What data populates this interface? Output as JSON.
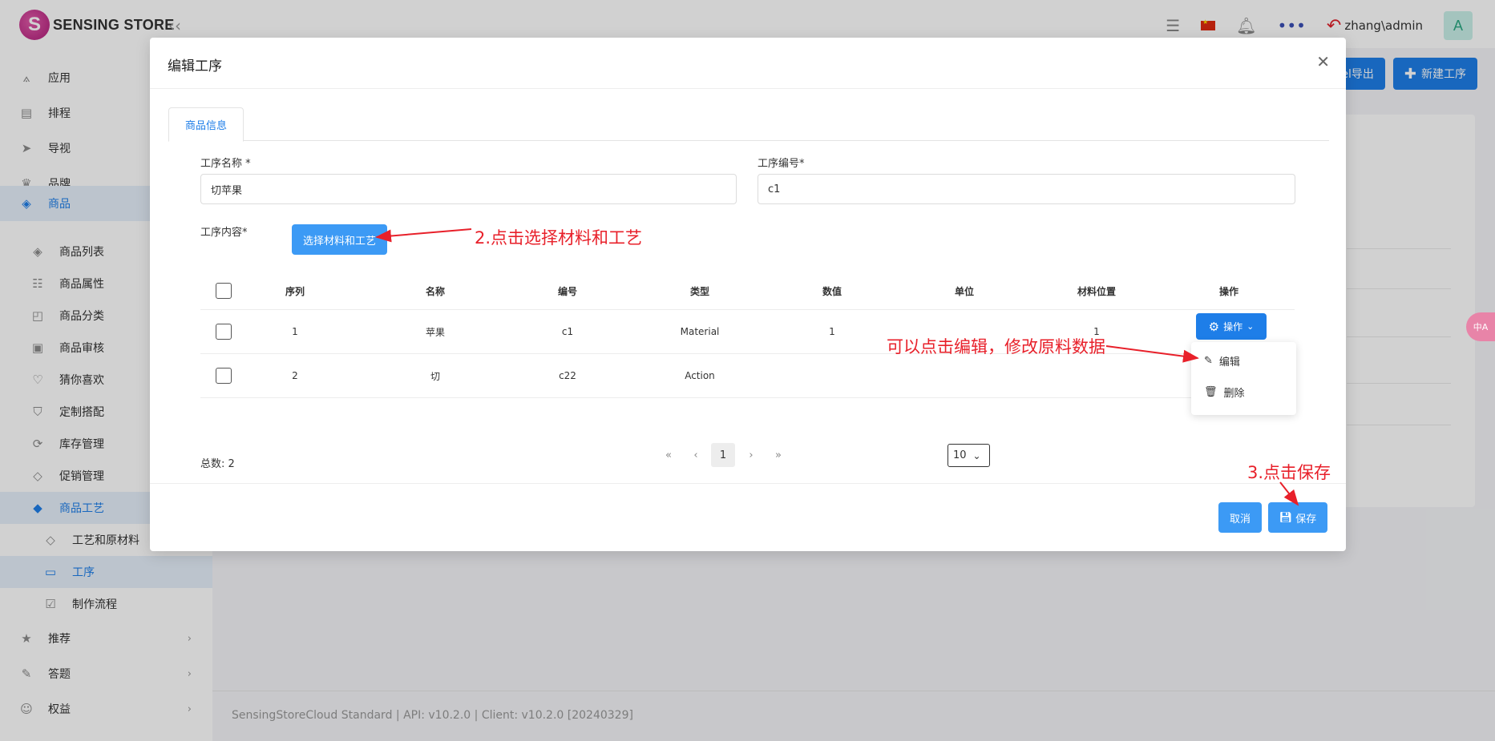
{
  "app": {
    "logo_text": "SENSING STORE",
    "logo_mark": "S",
    "user": "zhang\\admin",
    "avatar": "A",
    "top_buttons": {
      "export": "cel导出",
      "new": "新建工序"
    },
    "footer": "SensingStoreCloud Standard | API: v10.2.0 | Client: v10.2.0 [20240329]",
    "side_badge": "中A"
  },
  "sidebar": {
    "items": [
      {
        "label": "应用",
        "icon": "apps-icon"
      },
      {
        "label": "排程",
        "icon": "calendar-icon"
      },
      {
        "label": "导视",
        "icon": "navigation-icon"
      },
      {
        "label": "品牌",
        "icon": "crown-icon"
      },
      {
        "label": "商品",
        "icon": "cube-icon"
      },
      {
        "label": "商品列表",
        "icon": "cube-icon"
      },
      {
        "label": "商品属性",
        "icon": "list-icon"
      },
      {
        "label": "商品分类",
        "icon": "bag-icon"
      },
      {
        "label": "商品审核",
        "icon": "audit-icon"
      },
      {
        "label": "猜你喜欢",
        "icon": "heart-icon"
      },
      {
        "label": "定制搭配",
        "icon": "shirt-icon"
      },
      {
        "label": "库存管理",
        "icon": "sync-icon"
      },
      {
        "label": "促销管理",
        "icon": "tag-icon"
      },
      {
        "label": "商品工艺",
        "icon": "diamond-icon"
      },
      {
        "label": "工艺和原材料",
        "icon": "diamond-icon"
      },
      {
        "label": "工序",
        "icon": "chat-icon"
      },
      {
        "label": "制作流程",
        "icon": "checklist-icon"
      },
      {
        "label": "推荐",
        "icon": "star-icon"
      },
      {
        "label": "答题",
        "icon": "edit-icon"
      },
      {
        "label": "权益",
        "icon": "user-icon"
      }
    ]
  },
  "modal": {
    "title": "编辑工序",
    "tab": "商品信息",
    "name_label": "工序名称 *",
    "name_value": "切苹果",
    "code_label": "工序编号*",
    "code_value": "c1",
    "content_label": "工序内容*",
    "select_button": "选择材料和工艺",
    "table": {
      "headers": [
        "序列",
        "名称",
        "编号",
        "类型",
        "数值",
        "单位",
        "材料位置",
        "操作"
      ],
      "rows": [
        [
          "1",
          "苹果",
          "c1",
          "Material",
          "1",
          "",
          "1"
        ],
        [
          "2",
          "切",
          "c22",
          "Action",
          "",
          "",
          ""
        ]
      ]
    },
    "op_button": "操作",
    "dropdown": {
      "edit": "编辑",
      "delete": "删除"
    },
    "total": "总数: 2",
    "pager": {
      "first": "«",
      "prev": "‹",
      "current": "1",
      "next": "›",
      "last": "»",
      "page_size": "10"
    },
    "cancel": "取消",
    "save": "保存"
  },
  "annotations": {
    "a2": "2.点击选择材料和工艺",
    "a_edit": "可以点击编辑，修改原料数据",
    "a3": "3.点击保存",
    "color": "#e8202a"
  }
}
